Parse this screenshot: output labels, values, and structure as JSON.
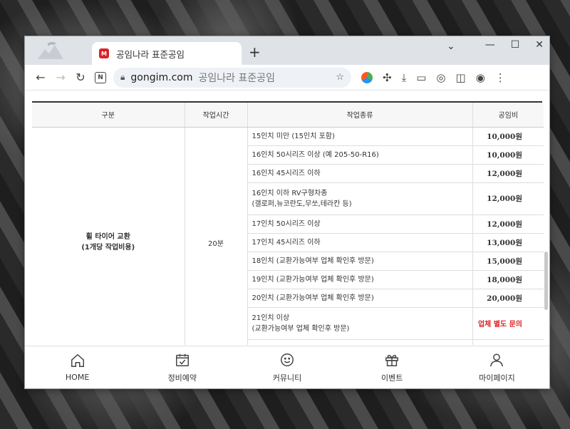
{
  "browser": {
    "tab_title": "공임나라 표준공임",
    "favicon_text": "M",
    "new_tab": "+",
    "url": "gongim.com",
    "page_title": "공임나라 표준공임"
  },
  "table": {
    "headers": [
      "구분",
      "작업시간",
      "작업종류",
      "공임비"
    ],
    "category": "휠 타이어 교환",
    "category_note": "(1개당 작업비용)",
    "time": "20분",
    "rows": [
      {
        "work": "15인치 미만 (15인치 포함)",
        "work2": "",
        "price": "10,000원"
      },
      {
        "work": "16인치 50시리즈 이상  (예 205-50-R16)",
        "work2": "",
        "price": "10,000원"
      },
      {
        "work": "16인치 45시리즈 이하",
        "work2": "",
        "price": "12,000원"
      },
      {
        "work": "16인치 이하 RV구형차종",
        "work2": "(갤로퍼,뉴코란도,무쏘,테라칸 등)",
        "price": "12,000원"
      },
      {
        "work": "17인치 50시리즈 이상",
        "work2": "",
        "price": "12,000원"
      },
      {
        "work": "17인치 45시리즈 이하",
        "work2": "",
        "price": "13,000원"
      },
      {
        "work": "18인치 (교환가능여부 업체 확인후 방문)",
        "work2": "",
        "price": "15,000원"
      },
      {
        "work": "19인치 (교환가능여부 업체 확인후 방문)",
        "work2": "",
        "price": "18,000원"
      },
      {
        "work": "20인치 (교환가능여부 업체 확인후 방문)",
        "work2": "",
        "price": "20,000원"
      },
      {
        "work": "21인치 이상",
        "work2": "(교환가능여부 업체 확인후 방문)",
        "price": "업체 별도 문의"
      }
    ]
  },
  "bottom_nav": [
    {
      "label": "HOME",
      "icon": "home-icon"
    },
    {
      "label": "정비예약",
      "icon": "calendar-icon"
    },
    {
      "label": "커뮤니티",
      "icon": "smile-icon"
    },
    {
      "label": "이벤트",
      "icon": "gift-icon"
    },
    {
      "label": "마이페이지",
      "icon": "user-icon"
    }
  ],
  "colors": {
    "accent_red": "#e02020",
    "favicon_red": "#d8232a"
  }
}
